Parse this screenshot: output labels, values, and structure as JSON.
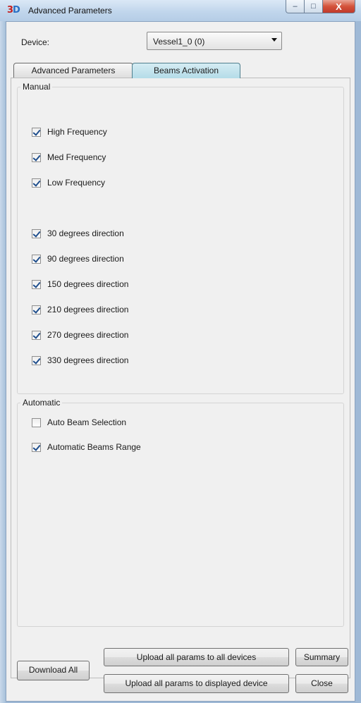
{
  "window": {
    "title": "Advanced Parameters",
    "icon_text_a": "3",
    "icon_text_b": "D",
    "controls": {
      "minimize": "–",
      "maximize": "□",
      "close": "X"
    }
  },
  "device": {
    "label": "Device:",
    "selected": "Vessel1_0 (0)"
  },
  "tabs": [
    {
      "label": "Advanced Parameters",
      "active": false
    },
    {
      "label": "Beams Activation",
      "active": true
    }
  ],
  "manual": {
    "title": "Manual",
    "frequencies": [
      {
        "label": "High Frequency",
        "checked": true
      },
      {
        "label": "Med Frequency",
        "checked": true
      },
      {
        "label": "Low Frequency",
        "checked": true
      }
    ],
    "directions": [
      {
        "label": "30 degrees direction",
        "checked": true
      },
      {
        "label": "90 degrees direction",
        "checked": true
      },
      {
        "label": "150 degrees direction",
        "checked": true
      },
      {
        "label": "210 degrees direction",
        "checked": true
      },
      {
        "label": "270 degrees direction",
        "checked": true
      },
      {
        "label": "330 degrees direction",
        "checked": true
      }
    ]
  },
  "automatic": {
    "title": "Automatic",
    "options": [
      {
        "label": "Auto Beam Selection",
        "checked": false
      },
      {
        "label": "Automatic Beams Range",
        "checked": true
      }
    ]
  },
  "buttons": {
    "download_all": "Download All",
    "upload_all": "Upload all params to all devices",
    "upload_displayed": "Upload all params to displayed device",
    "summary": "Summary",
    "close": "Close"
  },
  "colors": {
    "accent_tab": "#b4dce8",
    "checkmark": "#1f4e8c",
    "close_button": "#c0392b"
  }
}
